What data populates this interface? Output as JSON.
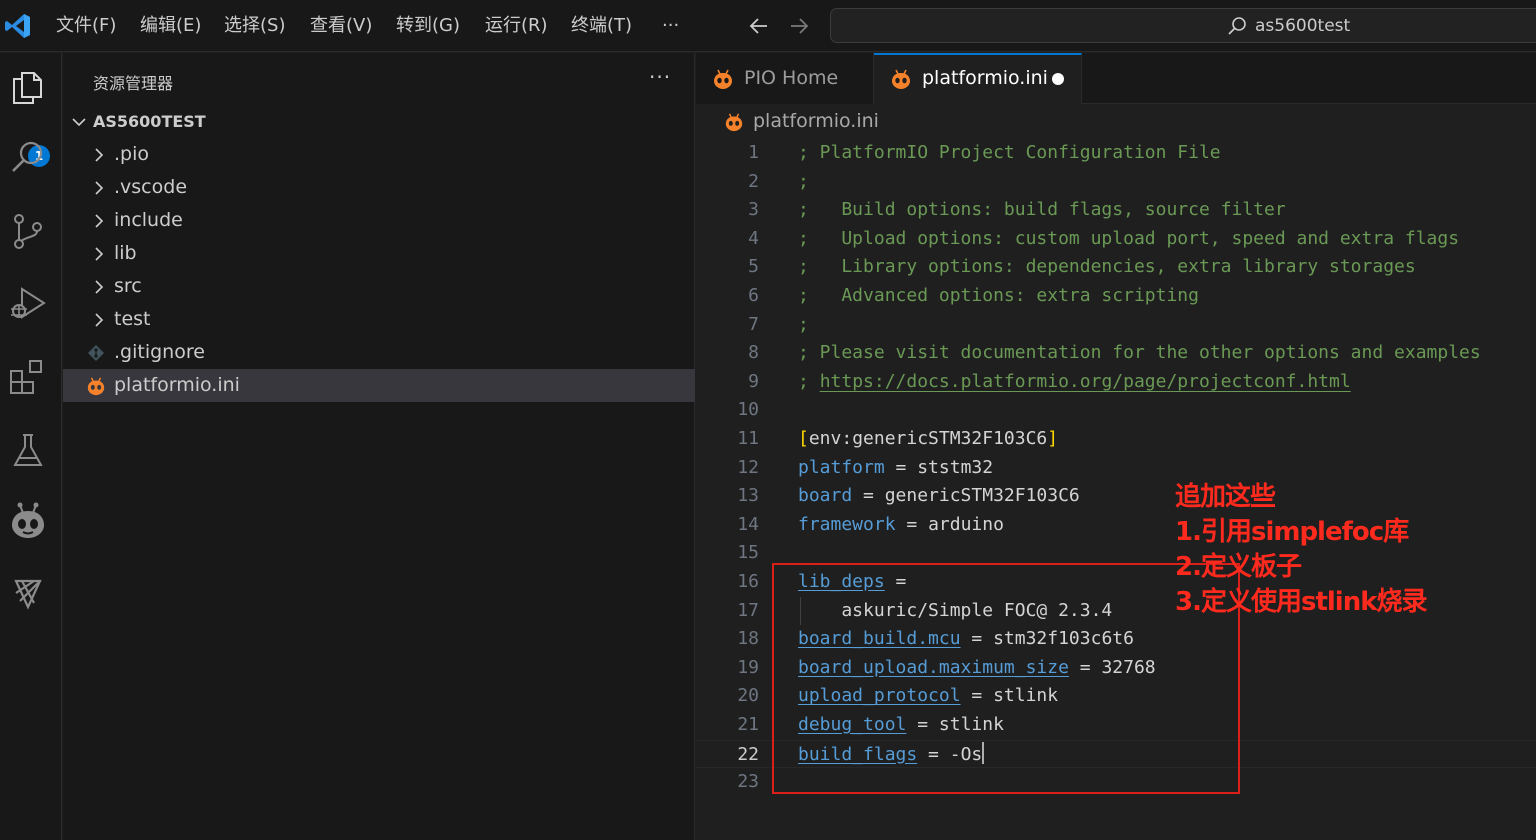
{
  "menubar": {
    "items": [
      "文件(F)",
      "编辑(E)",
      "选择(S)",
      "查看(V)",
      "转到(G)",
      "运行(R)",
      "终端(T)",
      "···"
    ]
  },
  "search": {
    "text": "as5600test",
    "icon": "search-icon"
  },
  "activitybar": {
    "icons": [
      "explorer-icon",
      "search-icon",
      "source-control-icon",
      "run-debug-icon",
      "extensions-icon",
      "testing-icon",
      "platformio-icon",
      "remote-icon"
    ],
    "explorer_badge": "1"
  },
  "sidebar": {
    "title": "资源管理器",
    "more": "···",
    "project": "AS5600TEST",
    "items": [
      {
        "label": ".pio",
        "kind": "folder"
      },
      {
        "label": ".vscode",
        "kind": "folder"
      },
      {
        "label": "include",
        "kind": "folder"
      },
      {
        "label": "lib",
        "kind": "folder"
      },
      {
        "label": "src",
        "kind": "folder"
      },
      {
        "label": "test",
        "kind": "folder"
      },
      {
        "label": ".gitignore",
        "kind": "git-file"
      },
      {
        "label": "platformio.ini",
        "kind": "pio-file",
        "selected": true
      }
    ]
  },
  "tabs": [
    {
      "label": "PIO Home",
      "active": false
    },
    {
      "label": "platformio.ini",
      "active": true,
      "dirty": true
    }
  ],
  "breadcrumb": "platformio.ini",
  "editor": {
    "active_line": "22",
    "lines": [
      {
        "n": "1",
        "text": "; PlatformIO Project Configuration File"
      },
      {
        "n": "2",
        "text": ";"
      },
      {
        "n": "3",
        "text": ";   Build options: build flags, source filter"
      },
      {
        "n": "4",
        "text": ";   Upload options: custom upload port, speed and extra flags"
      },
      {
        "n": "5",
        "text": ";   Library options: dependencies, extra library storages"
      },
      {
        "n": "6",
        "text": ";   Advanced options: extra scripting"
      },
      {
        "n": "7",
        "text": ";"
      },
      {
        "n": "8",
        "text": "; Please visit documentation for the other options and examples"
      },
      {
        "n": "9",
        "prefix": "; ",
        "url": "https://docs.platformio.org/page/projectconf.html"
      },
      {
        "n": "10"
      },
      {
        "n": "11",
        "section_open": "[",
        "section": "env:genericSTM32F103C6",
        "section_close": "]"
      },
      {
        "n": "12",
        "key": "platform",
        "eq": " = ",
        "value": "ststm32"
      },
      {
        "n": "13",
        "key": "board",
        "eq": " = ",
        "value": "genericSTM32F103C6"
      },
      {
        "n": "14",
        "key": "framework",
        "eq": " = ",
        "value": "arduino"
      },
      {
        "n": "15"
      },
      {
        "n": "16",
        "key": "lib_deps",
        "eq": " =",
        "value": ""
      },
      {
        "n": "17",
        "value": "    askuric/Simple FOC@ 2.3.4"
      },
      {
        "n": "18",
        "key": "board_build.mcu",
        "eq": " = ",
        "value": "stm32f103c6t6"
      },
      {
        "n": "19",
        "key": "board_upload.maximum_size",
        "eq": " = ",
        "value": "32768"
      },
      {
        "n": "20",
        "key": "upload_protocol",
        "eq": " = ",
        "value": "stlink"
      },
      {
        "n": "21",
        "key": "debug_tool",
        "eq": " = ",
        "value": "stlink"
      },
      {
        "n": "22",
        "key": "build_flags",
        "eq": " = ",
        "value": "-Os"
      },
      {
        "n": "23"
      }
    ]
  },
  "annotation": {
    "lines": [
      "追加这些",
      "1.引用simplefoc库",
      "2.定义板子",
      "3.定义使用stlink烧录"
    ],
    "color": "#ff2a1e"
  }
}
